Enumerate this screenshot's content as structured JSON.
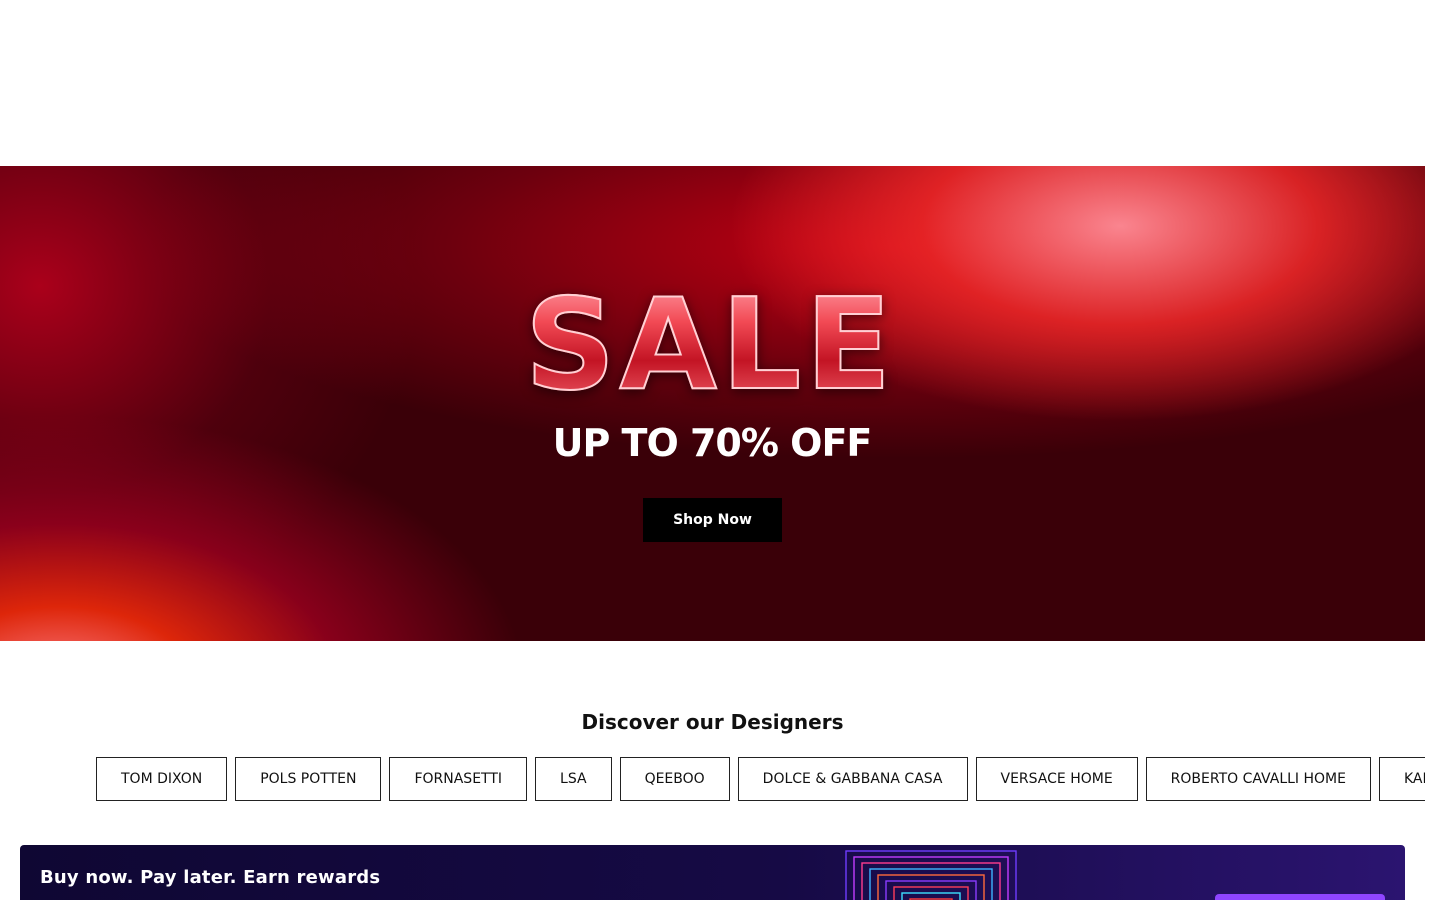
{
  "hero": {
    "headline": "SALE",
    "subheadline": "UP TO 70% OFF",
    "cta_label": "Shop Now"
  },
  "designers": {
    "title": "Discover our Designers",
    "items": [
      "TOM DIXON",
      "POLS POTTEN",
      "FORNASETTI",
      "LSA",
      "QEEBOO",
      "DOLCE & GABBANA CASA",
      "VERSACE HOME",
      "ROBERTO CAVALLI HOME",
      "KARTELL"
    ]
  },
  "bnpl_banner": {
    "text": "Buy now. Pay later. Earn rewards"
  },
  "colors": {
    "cta_background": "#000000",
    "banner_background": "#160a45",
    "banner_button": "#8f45ff"
  }
}
